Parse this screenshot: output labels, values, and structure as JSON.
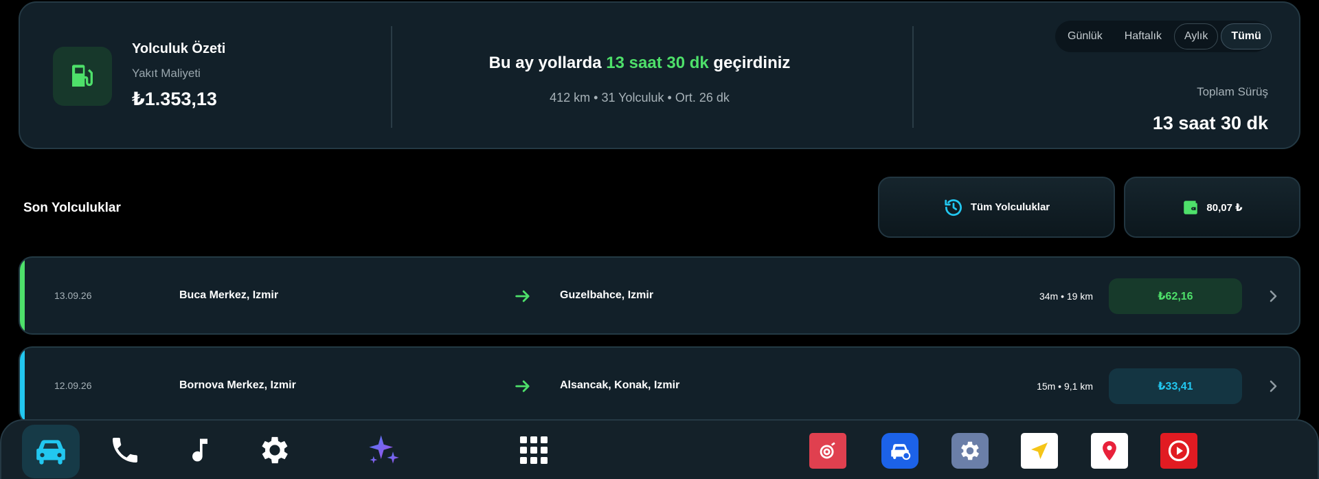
{
  "summary": {
    "title": "Yolculuk Özeti",
    "subtitle": "Yakıt Maliyeti",
    "cost": "₺1.353,13",
    "headline_prefix": "Bu ay yollarda ",
    "headline_highlight": "13 saat 30 dk",
    "headline_suffix": " geçirdiniz",
    "stats": "412 km • 31 Yolculuk • Ort. 26 dk",
    "period_tabs": [
      "Günlük",
      "Haftalık",
      "Aylık",
      "Tümü"
    ],
    "selected_period": "Tümü",
    "total_label": "Toplam Sürüş",
    "total_value": "13 saat 30 dk"
  },
  "recent": {
    "title": "Son Yolculuklar",
    "all_trips_label": "Tüm Yolculuklar",
    "wallet_label": "80,07 ₺"
  },
  "trips": [
    {
      "date": "13.09.26",
      "from": "Buca Merkez, Izmir",
      "to": "Guzelbahce, Izmir",
      "meta": "34m • 19 km",
      "price": "₺62,16",
      "accent": "#4ee06a",
      "price_bg": "#173a2b",
      "price_color": "#4ee06a"
    },
    {
      "date": "12.09.26",
      "from": "Bornova Merkez, Izmir",
      "to": "Alsancak, Konak, Izmir",
      "meta": "15m • 9,1 km",
      "price": "₺33,41",
      "accent": "#22c7f0",
      "price_bg": "#143542",
      "price_color": "#22c7f0"
    }
  ],
  "dock": {
    "nav_icons": [
      "car-icon",
      "phone-icon",
      "music-icon",
      "settings-icon",
      "sparkle-icon",
      "apps-grid-icon"
    ],
    "app_icons": [
      "camera-app-icon",
      "car-service-app-icon",
      "gear-app-icon",
      "navigation-app-icon",
      "map-pin-app-icon",
      "video-player-app-icon"
    ]
  },
  "colors": {
    "accent_green": "#4ee06a",
    "accent_cyan": "#22c7f0",
    "card_bg": "#122029"
  }
}
